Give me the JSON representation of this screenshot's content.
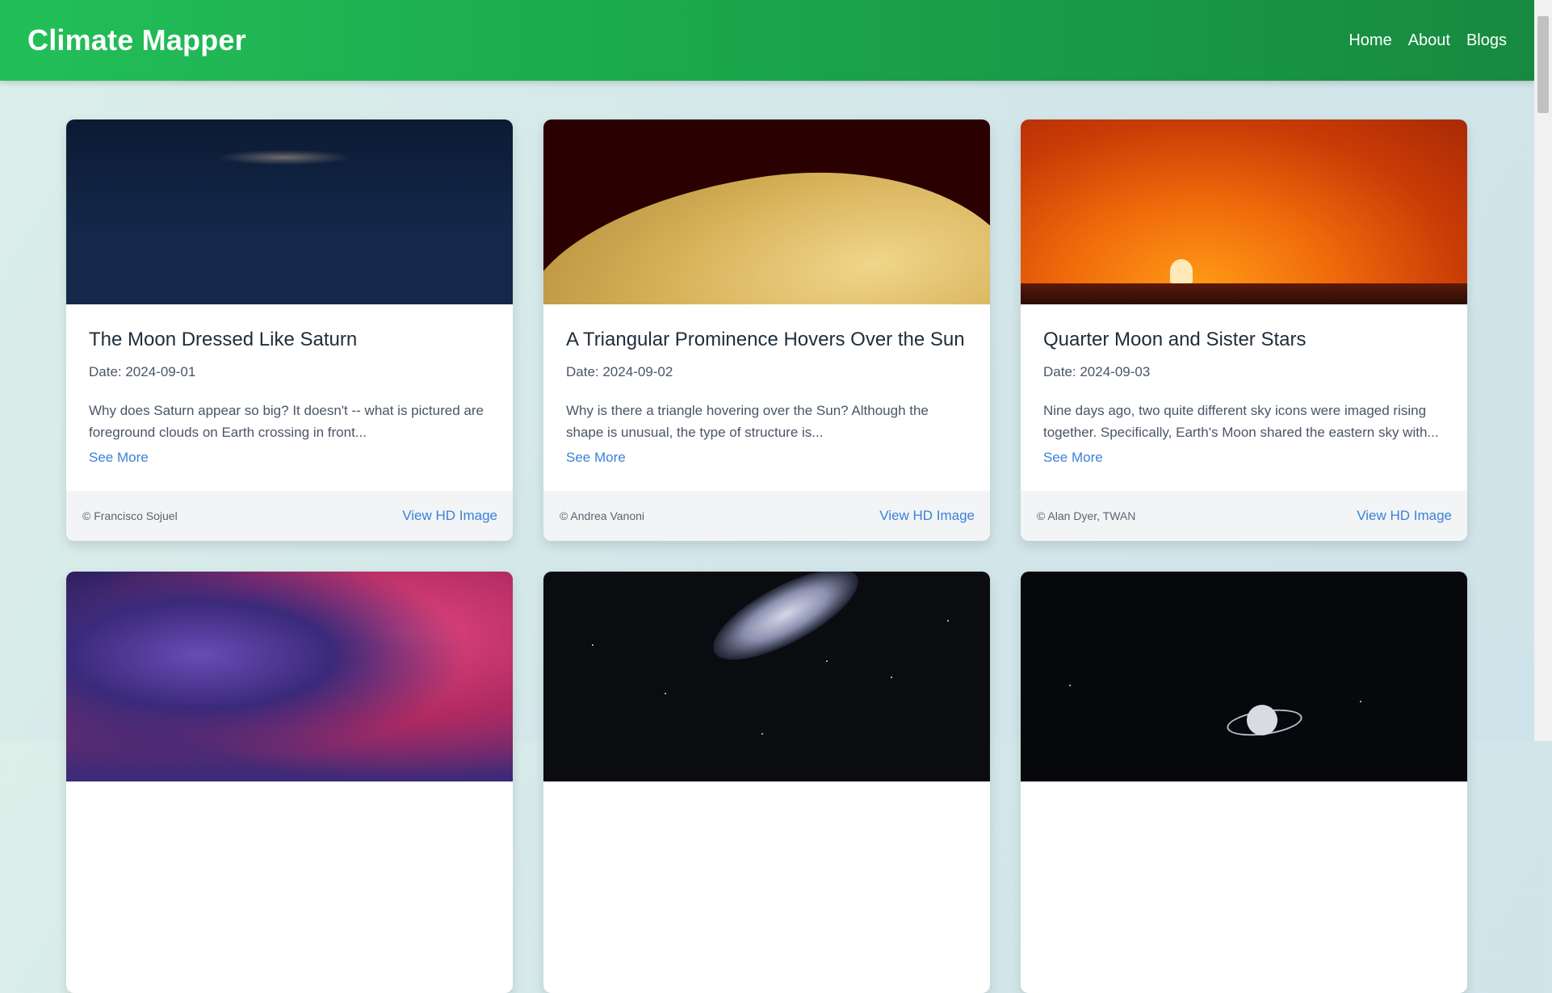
{
  "app": {
    "brand": "Climate Mapper",
    "nav": [
      "Home",
      "About",
      "Blogs"
    ]
  },
  "cards": [
    {
      "title": "The Moon Dressed Like Saturn",
      "date": "Date: 2024-09-01",
      "description": "Why does Saturn appear so big? It doesn't -- what is pictured are foreground clouds on Earth crossing in front...",
      "see_more": "See More",
      "credit": "© Francisco Sojuel",
      "hd_link": "View HD Image"
    },
    {
      "title": "A Triangular Prominence Hovers Over the Sun",
      "date": "Date: 2024-09-02",
      "description": "Why is there a triangle hovering over the Sun? Although the shape is unusual, the type of structure is...",
      "see_more": "See More",
      "credit": "© Andrea Vanoni",
      "hd_link": "View HD Image"
    },
    {
      "title": "Quarter Moon and Sister Stars",
      "date": "Date: 2024-09-03",
      "description": "Nine days ago, two quite different sky icons were imaged rising together. Specifically, Earth's Moon shared the eastern sky with...",
      "see_more": "See More",
      "credit": "© Alan Dyer, TWAN",
      "hd_link": "View HD Image"
    }
  ],
  "theme": {
    "header_green": "#22bf58",
    "link_blue": "#3b82d6"
  }
}
